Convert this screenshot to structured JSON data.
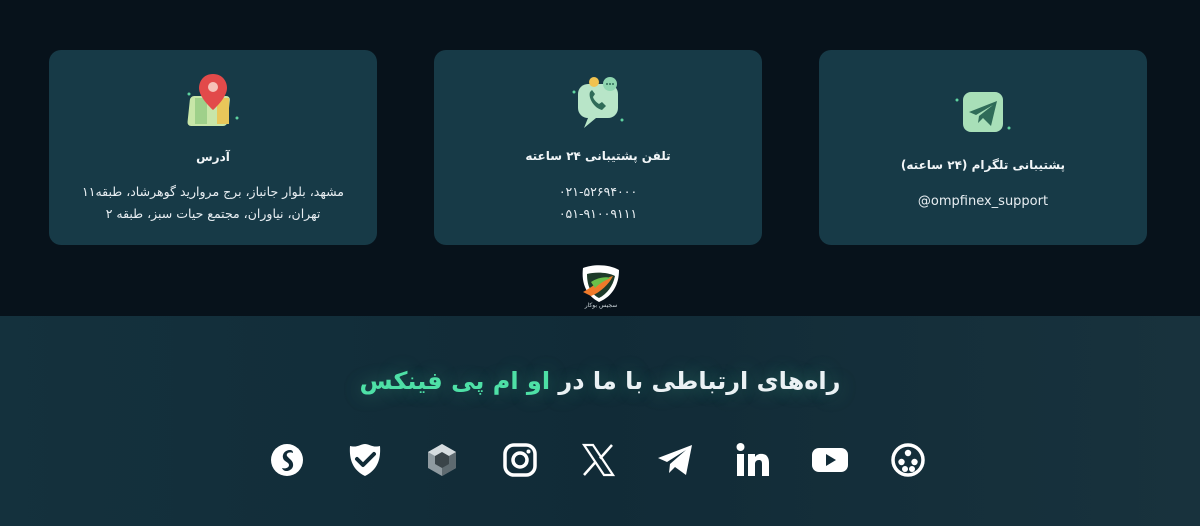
{
  "cards": {
    "address": {
      "title": "آدرس",
      "line1": "مشهد، بلوار جانباز، برج مروارید گوهرشاد، طبقه۱۱",
      "line2": "تهران، نیاوران، مجتمع حیات سبز، طبقه ۲",
      "icon": "map-pin-icon"
    },
    "phone": {
      "title": "تلفن پشتیبانی ۲۴ ساعته",
      "line1": "۰۲۱-۵۲۶۹۴۰۰۰",
      "line2": "۰۵۱-۹۱۰۰۹۱۱۱",
      "icon": "phone-chat-icon"
    },
    "telegram": {
      "title": "پشتیبانی تلگرام (۲۴ ساعته)",
      "line1": "@ompfinex_support",
      "icon": "paper-plane-icon"
    }
  },
  "logo": {
    "caption": "سجیس بوکار"
  },
  "footer": {
    "heading_main": "راه‌های ارتباطی با ما در ",
    "heading_accent": "او ام پی فینکس"
  },
  "socials": [
    {
      "name": "aparat-icon"
    },
    {
      "name": "youtube-icon"
    },
    {
      "name": "linkedin-icon"
    },
    {
      "name": "telegram-icon"
    },
    {
      "name": "x-icon"
    },
    {
      "name": "instagram-icon"
    },
    {
      "name": "cube-icon"
    },
    {
      "name": "virgool-icon"
    },
    {
      "name": "rubika-icon"
    }
  ],
  "colors": {
    "card_bg": "#173a47",
    "page_bg": "#07121b",
    "accent": "#4ee0a6"
  }
}
